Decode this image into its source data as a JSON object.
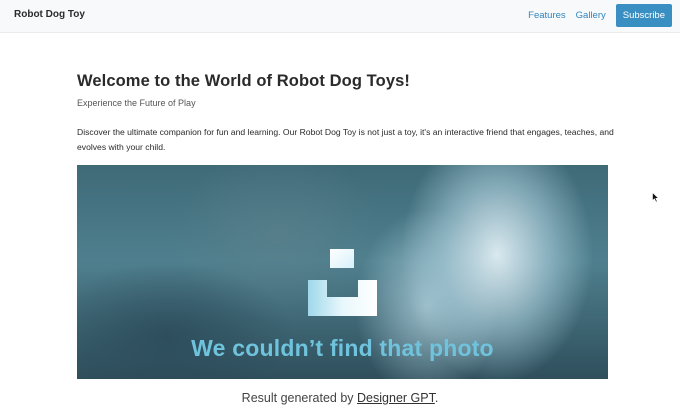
{
  "navbar": {
    "brand": "Robot Dog Toy",
    "links": [
      {
        "label": "Features"
      },
      {
        "label": "Gallery"
      }
    ],
    "subscribe_label": "Subscribe"
  },
  "main": {
    "title": "Welcome to the World of Robot Dog Toys!",
    "subtitle": "Experience the Future of Play",
    "intro": "Discover the ultimate companion for fun and learning. Our Robot Dog Toy is not just a toy, it's an interactive friend that engages, teaches, and evolves with your child.",
    "image_placeholder": {
      "caption": "We couldn’t find that photo",
      "icon": "image-missing-icon"
    }
  },
  "footer": {
    "prefix": "Result generated by ",
    "link_label": "Designer GPT",
    "suffix": "."
  },
  "colors": {
    "link": "#2f86c1",
    "button": "#3a8fc2",
    "navbar_bg": "#f8f9fa",
    "caption": "#6fc3dc"
  }
}
